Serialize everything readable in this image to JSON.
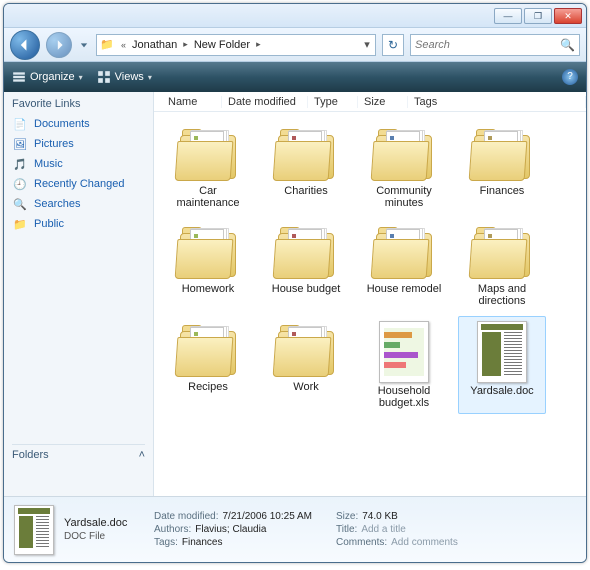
{
  "titlebar": {
    "minimize": "—",
    "maximize": "❐",
    "close": "✕"
  },
  "nav": {
    "back_breadcrumb_sep": "«",
    "crumb1": "Jonathan",
    "crumb2": "New Folder",
    "sep": "▸",
    "addr_dropdown": "▾",
    "refresh": "↻"
  },
  "search": {
    "placeholder": "Search"
  },
  "toolbar": {
    "organize": "Organize",
    "views": "Views",
    "dropdown": "▾"
  },
  "sidebar": {
    "header": "Favorite Links",
    "items": [
      {
        "label": "Documents",
        "icon": "documents-icon"
      },
      {
        "label": "Pictures",
        "icon": "pictures-icon"
      },
      {
        "label": "Music",
        "icon": "music-icon"
      },
      {
        "label": "Recently Changed",
        "icon": "recently-changed-icon"
      },
      {
        "label": "Searches",
        "icon": "searches-icon"
      },
      {
        "label": "Public",
        "icon": "public-icon"
      }
    ],
    "folders_header": "Folders",
    "folders_chevron": "˄"
  },
  "columns": {
    "name": "Name",
    "date": "Date modified",
    "type": "Type",
    "size": "Size",
    "tags": "Tags"
  },
  "items": [
    {
      "label": "Car maintenance",
      "kind": "folder"
    },
    {
      "label": "Charities",
      "kind": "folder"
    },
    {
      "label": "Community minutes",
      "kind": "folder"
    },
    {
      "label": "Finances",
      "kind": "folder"
    },
    {
      "label": "Homework",
      "kind": "folder"
    },
    {
      "label": "House budget",
      "kind": "folder"
    },
    {
      "label": "House remodel",
      "kind": "folder"
    },
    {
      "label": "Maps and directions",
      "kind": "folder"
    },
    {
      "label": "Recipes",
      "kind": "folder"
    },
    {
      "label": "Work",
      "kind": "folder"
    },
    {
      "label": "Household budget.xls",
      "kind": "xls"
    },
    {
      "label": "Yardsale.doc",
      "kind": "doc",
      "selected": true
    }
  ],
  "details": {
    "filename": "Yardsale.doc",
    "filetype": "DOC File",
    "meta": {
      "date_modified_k": "Date modified:",
      "date_modified_v": "7/21/2006 10:25 AM",
      "authors_k": "Authors:",
      "authors_v": "Flavius; Claudia",
      "tags_k": "Tags:",
      "tags_v": "Finances",
      "size_k": "Size:",
      "size_v": "74.0 KB",
      "title_k": "Title:",
      "title_v": "Add a title",
      "comments_k": "Comments:",
      "comments_v": "Add comments"
    }
  }
}
